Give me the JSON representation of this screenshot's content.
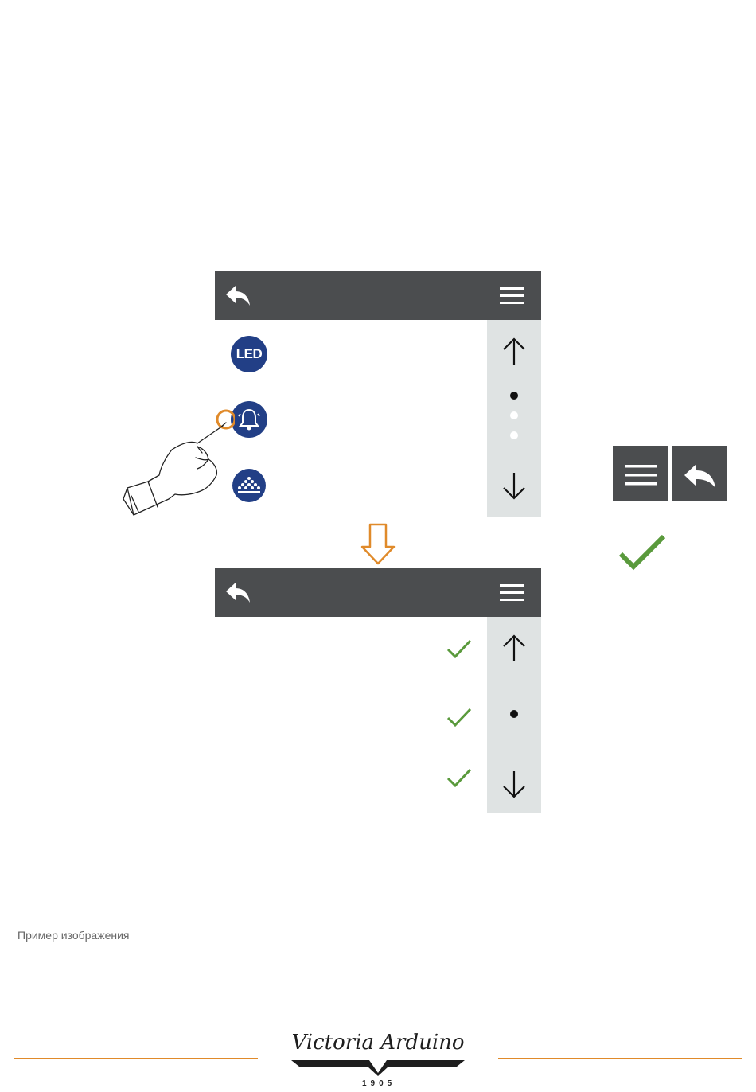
{
  "caption": "Пример изображения",
  "brand": {
    "logo_text": "Victoria Arduino",
    "year": "1905",
    "accent_color": "#e08a2a"
  },
  "colors": {
    "topbar": "#4b4d4f",
    "scrollbar": "#dfe3e3",
    "icon_blue": "#223f86",
    "check_green": "#5a9a3c",
    "touch_orange": "#e08a2a"
  },
  "screen_before": {
    "topbar_icons": [
      "back-arrow-icon",
      "hamburger-menu-icon"
    ],
    "rows": [
      {
        "icon": "led-icon",
        "text": "LED"
      },
      {
        "icon": "bell-icon",
        "selected_by_touch": true
      },
      {
        "icon": "cup-warmer-icon"
      }
    ],
    "scroll": {
      "up_icon": "arrow-up-icon",
      "down_icon": "arrow-down-icon",
      "pages": 3,
      "current_page": 1
    }
  },
  "screen_after": {
    "topbar_icons": [
      "back-arrow-icon",
      "hamburger-menu-icon"
    ],
    "rows": [
      {
        "icon": "check-icon",
        "checked": true
      },
      {
        "icon": "check-icon",
        "checked": true
      },
      {
        "icon": "check-icon",
        "checked": true
      }
    ],
    "scroll": {
      "up_icon": "arrow-up-icon",
      "down_icon": "arrow-down-icon",
      "pages": 1,
      "current_page": 1
    }
  },
  "legend": {
    "icons": [
      "hamburger-menu-icon",
      "back-arrow-icon",
      "check-icon"
    ]
  }
}
